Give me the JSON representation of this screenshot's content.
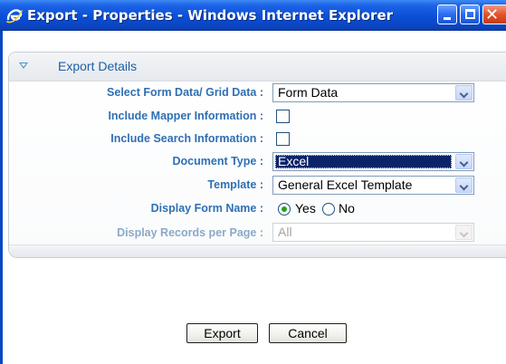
{
  "window": {
    "title": "Export - Properties - Windows Internet Explorer",
    "icon": "internet-explorer-icon",
    "title_bar_color": "#0a4fd6"
  },
  "section": {
    "title": "Export Details",
    "header_color": "#1d5fa8"
  },
  "form": {
    "form_grid_label": "Select Form Data/ Grid Data :",
    "form_grid_value": "Form Data",
    "mapper_label": "Include Mapper Information :",
    "mapper_checked": false,
    "search_label": "Include Search Information :",
    "search_checked": false,
    "doc_type_label": "Document Type :",
    "doc_type_value": "Excel",
    "template_label": "Template :",
    "template_value": "General Excel Template",
    "display_name_label": "Display Form Name :",
    "display_name_yes": "Yes",
    "display_name_no": "No",
    "display_name_selected": "Yes",
    "records_label": "Display Records per Page :",
    "records_value": "All"
  },
  "buttons": {
    "export": "Export",
    "cancel": "Cancel"
  },
  "colors": {
    "label_blue": "#2f6fb4",
    "selection_navy": "#0a246a",
    "radio_green": "#21a121"
  }
}
